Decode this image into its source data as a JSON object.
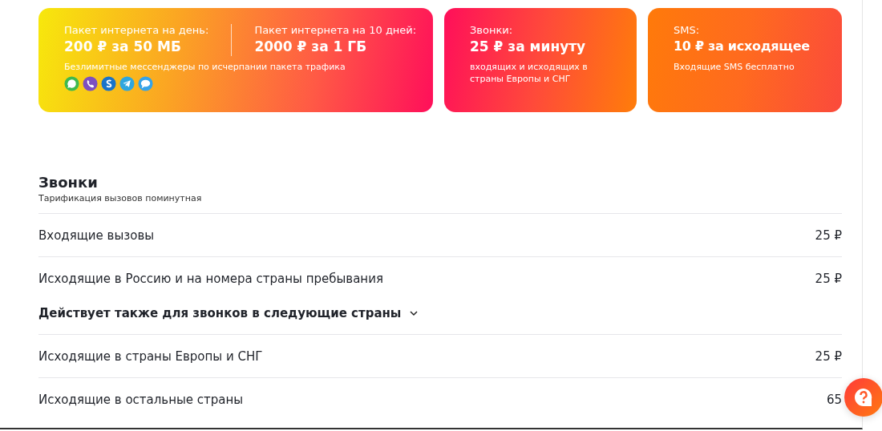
{
  "cards": [
    {
      "kind": "internet",
      "columns": [
        {
          "label": "Пакет интернета на день:",
          "price": "200 ₽ за 50 МБ"
        },
        {
          "label": "Пакет интернета на 10 дней:",
          "price": "2000 ₽ за 1 ГБ"
        }
      ],
      "note": "Безлимитные мессенджеры по исчерпании пакета трафика"
    },
    {
      "kind": "calls",
      "label": "Звонки:",
      "price": "25 ₽ за минуту",
      "note": "входящих и исходящих в страны Европы и СНГ"
    },
    {
      "kind": "sms",
      "label": "SMS:",
      "price": "10 ₽ за исходящее",
      "note": "Входящие SMS бесплатно"
    }
  ],
  "section": {
    "title": "Звонки",
    "subtitle": "Тарификация вызовов поминутная",
    "items": [
      {
        "kind": "row",
        "name": "Входящие вызовы",
        "price": "25 ₽"
      },
      {
        "kind": "row",
        "name": "Исходящие в Россию и на номера страны пребывания",
        "price": "25 ₽"
      },
      {
        "kind": "expander",
        "label": "Действует также для звонков в следующие страны",
        "expanded": false
      },
      {
        "kind": "row",
        "name": "Исходящие в страны Европы и СНГ",
        "price": "25 ₽"
      },
      {
        "kind": "row",
        "name": "Исходящие в остальные страны",
        "price": "65"
      }
    ]
  }
}
